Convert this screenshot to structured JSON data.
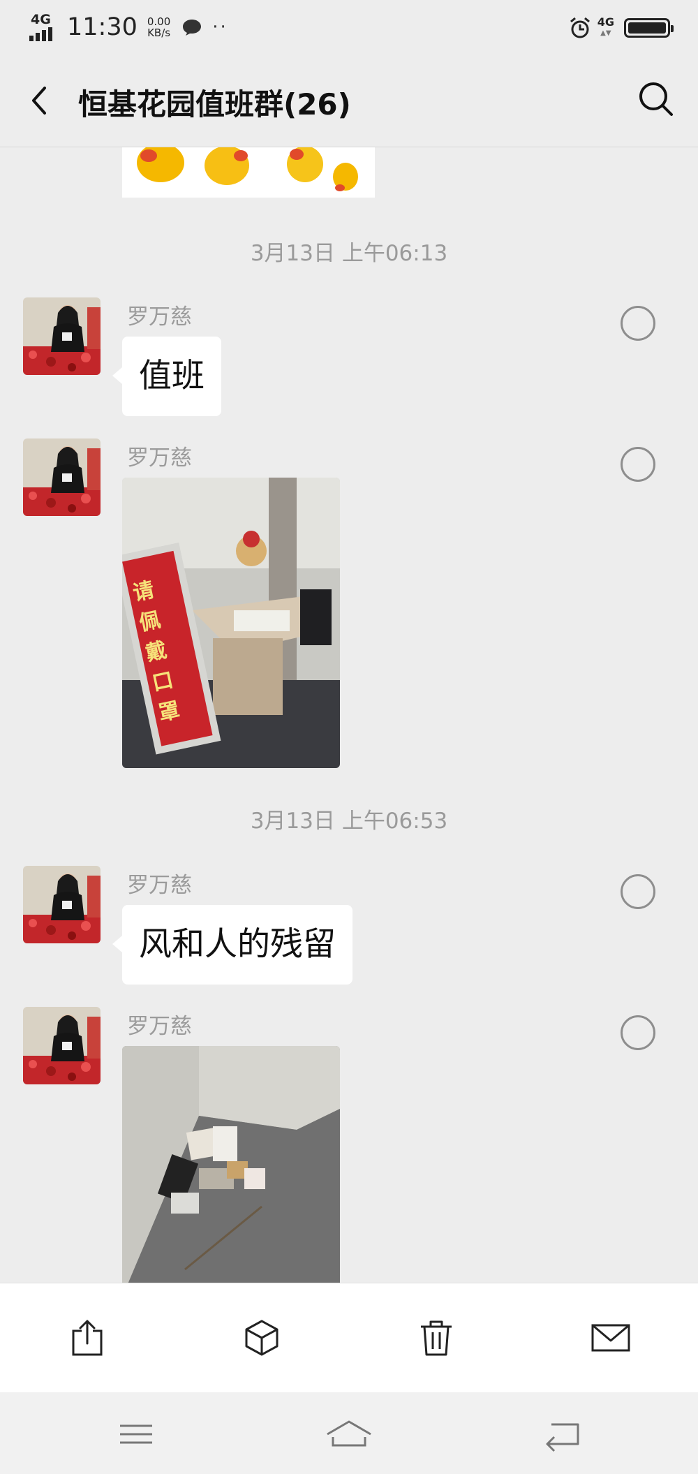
{
  "status_bar": {
    "network": "4G",
    "time": "11:30",
    "speed_value": "0.00",
    "speed_unit": "KB/s",
    "dots": "··",
    "right_network": "4G"
  },
  "header": {
    "title": "恒基花园值班群(26)"
  },
  "chat": {
    "messages": [
      {
        "timestamp": "3月13日 上午06:13"
      },
      {
        "sender": "罗万慈",
        "text": "值班"
      },
      {
        "sender": "罗万慈",
        "image": "photo-duty-desk",
        "sign_text": "请佩戴口罩"
      },
      {
        "timestamp": "3月13日 上午06:53"
      },
      {
        "sender": "罗万慈",
        "text": "风和人的残留"
      },
      {
        "sender": "罗万慈",
        "image": "photo-trash-corner"
      }
    ]
  },
  "action_bar": {
    "icons": [
      "share-icon",
      "box-icon",
      "trash-icon",
      "mail-icon"
    ]
  },
  "nav_bar": {
    "icons": [
      "menu-icon",
      "home-icon",
      "back-nav-icon"
    ]
  },
  "colors": {
    "background": "#ededed",
    "bubble": "#ffffff",
    "timestamp": "#9a9a9a"
  }
}
